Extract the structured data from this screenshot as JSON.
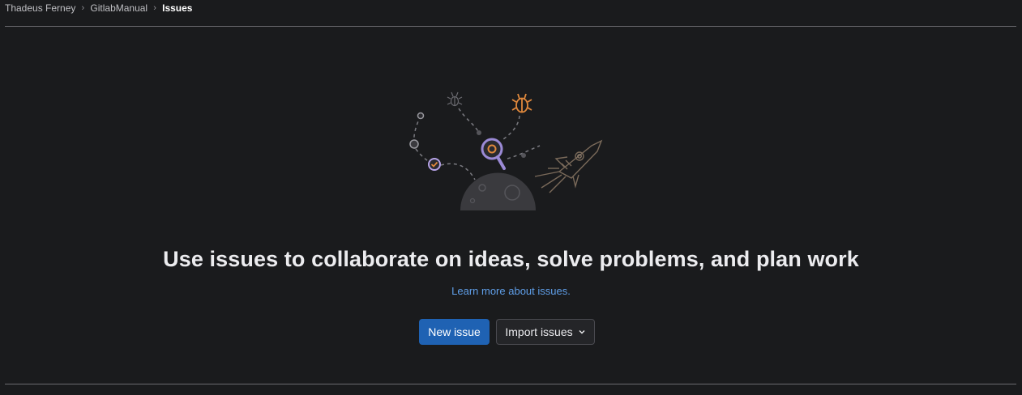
{
  "breadcrumb": {
    "items": [
      "Thadeus Ferney",
      "GitlabManual",
      "Issues"
    ]
  },
  "empty_state": {
    "title": "Use issues to collaborate on ideas, solve problems, and plan work",
    "learn_more": "Learn more about issues."
  },
  "actions": {
    "new_issue": "New issue",
    "import_issues": "Import issues"
  },
  "icons": {
    "breadcrumb_separator": "chevron-right-icon",
    "dropdown": "chevron-down-icon",
    "illustration": "issues-empty-state-illustration"
  },
  "colors": {
    "background": "#1a1b1d",
    "primary": "#1f62b3",
    "link": "#5f9ee8"
  }
}
